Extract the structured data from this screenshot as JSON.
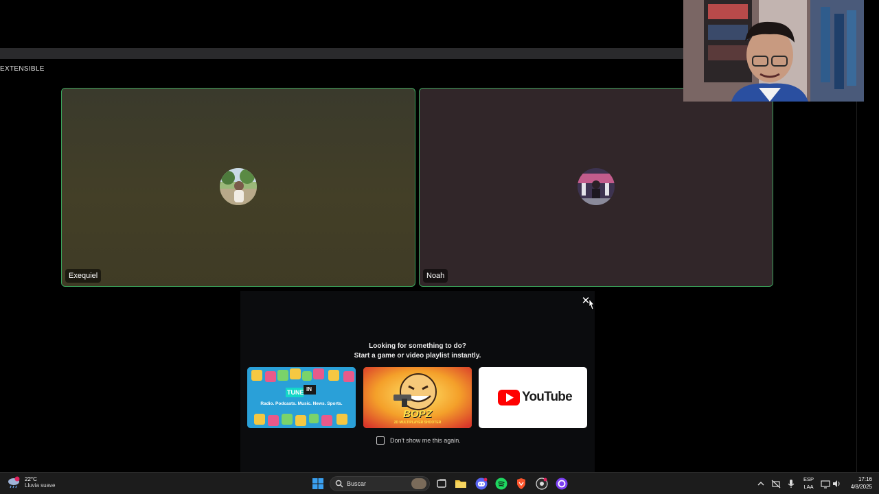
{
  "section_label": "EXTENSIBLE",
  "participants": [
    {
      "name": "Exequiel",
      "speaking": true
    },
    {
      "name": "Noah",
      "speaking": true
    }
  ],
  "popup": {
    "title": "Looking for something to do?",
    "subtitle": "Start a game or video playlist instantly.",
    "close_label": "✕",
    "activities": [
      {
        "name": "TuneIn",
        "logo_text": "TUNE",
        "logo_text2": "IN",
        "tagline": "Radio. Podcasts. Music. News. Sports."
      },
      {
        "name": "Bopz.io",
        "logo_text": "BOPZ",
        "tagline": "2D MULTIPLAYER SHOOTER"
      },
      {
        "name": "YouTube",
        "logo_text": "YouTube"
      }
    ],
    "dont_show_label": "Don't show me this again."
  },
  "taskbar": {
    "weather_temp": "22°C",
    "weather_desc": "Lluvia suave",
    "search_placeholder": "Buscar",
    "lang_top": "ESP",
    "lang_bottom": "LAA",
    "time": "17:16",
    "date": "4/8/2025"
  },
  "colors": {
    "speaking_border": "#3ba55c",
    "tile1_bg": "#433f27",
    "tile2_bg": "#312629",
    "popup_bg": "#0b0c0e",
    "youtube_red": "#ff0000"
  }
}
